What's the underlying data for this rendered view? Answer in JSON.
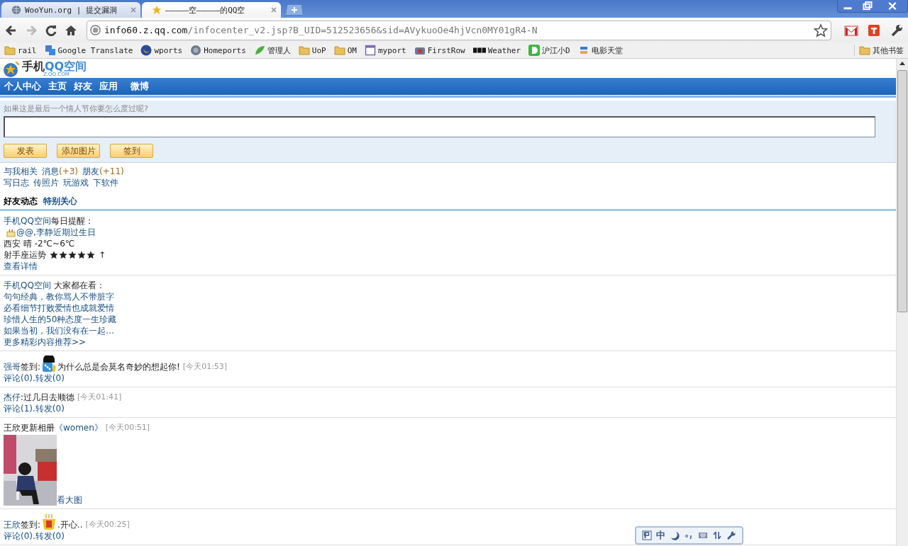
{
  "browser": {
    "tabs": [
      {
        "title": "WooYun.org | 提交漏洞",
        "selected": false
      },
      {
        "title": "—————空—————的QQ空",
        "selected": true
      }
    ],
    "address": {
      "host": "info60.z.qq.com",
      "path": "/infocenter_v2.jsp?B_UID=512523656&sid=AVykuoOe4hjVcn0MY01gR4-N"
    },
    "bookmarks": [
      "rail",
      "Google Translate",
      "wports",
      "Homeports",
      "管理人",
      "UoP",
      "OM",
      "myport",
      "FirstRow",
      "Weather",
      "沪江小D",
      "电影天堂"
    ],
    "other_bookmarks": "其他书签"
  },
  "page": {
    "logo": {
      "prefix": "手机",
      "brand": "QQ空间",
      "sub": "Z.QQ.COM"
    },
    "nav": [
      "个人中心",
      "主页",
      "好友",
      "应用",
      "微博"
    ],
    "composer": {
      "prompt": "如果这是最后一个情人节你要怎么度过呢?",
      "buttons": [
        "发表",
        "添加图片",
        "签到"
      ]
    },
    "links": [
      [
        {
          "label": "与我相关"
        },
        {
          "label": "消息",
          "count": "(+3)"
        },
        {
          "label": "朋友",
          "count": "(+11)"
        }
      ],
      [
        {
          "label": "写日志"
        },
        {
          "label": "传照片"
        },
        {
          "label": "玩游戏"
        },
        {
          "label": "下软件"
        }
      ]
    ],
    "feed_tabs": [
      {
        "label": "好友动态",
        "selected": true
      },
      {
        "label": "特别关心",
        "selected": false
      }
    ],
    "feed": [
      {
        "kind": "notice",
        "source": "手机QQ空间",
        "title": "每日提醒：",
        "birthday": "@@,李静近期过生日",
        "weather": "西安 晴 -2℃~6℃",
        "horoscope": "射手座运势",
        "stars": 5,
        "trend": "↑",
        "link": "查看详情"
      },
      {
        "kind": "recommend",
        "source": "手机QQ空间",
        "title": "大家都在看：",
        "items": [
          "句句经典，教你骂人不带脏字",
          "必看细节打败爱情也成就爱情",
          "珍惜人生的50种态度一生珍藏",
          "如果当初，我们没有在一起…"
        ],
        "more": "更多精彩内容推荐>>"
      },
      {
        "kind": "checkin",
        "user": "强哥",
        "action": "签到:",
        "text": "为什么总是会莫名奇妙的想起你!",
        "time": "[今天01:53]",
        "actions": "评论(0).转发(0)"
      },
      {
        "kind": "status",
        "user": "杰仔",
        "text": ":过几日去顺德",
        "time": "[今天01:41]",
        "actions": "评论(1).转发(0)"
      },
      {
        "kind": "album",
        "user": "王欣",
        "text": "更新相册",
        "album": "《women》",
        "time": "[今天00:51]",
        "view": "看大图"
      },
      {
        "kind": "checkin",
        "user": "王欣",
        "action": "签到:",
        "text": ".开心..",
        "time": "[今天00:25]",
        "actions": "评论(0).转发(0)"
      }
    ],
    "ime": {
      "label": "中"
    }
  }
}
